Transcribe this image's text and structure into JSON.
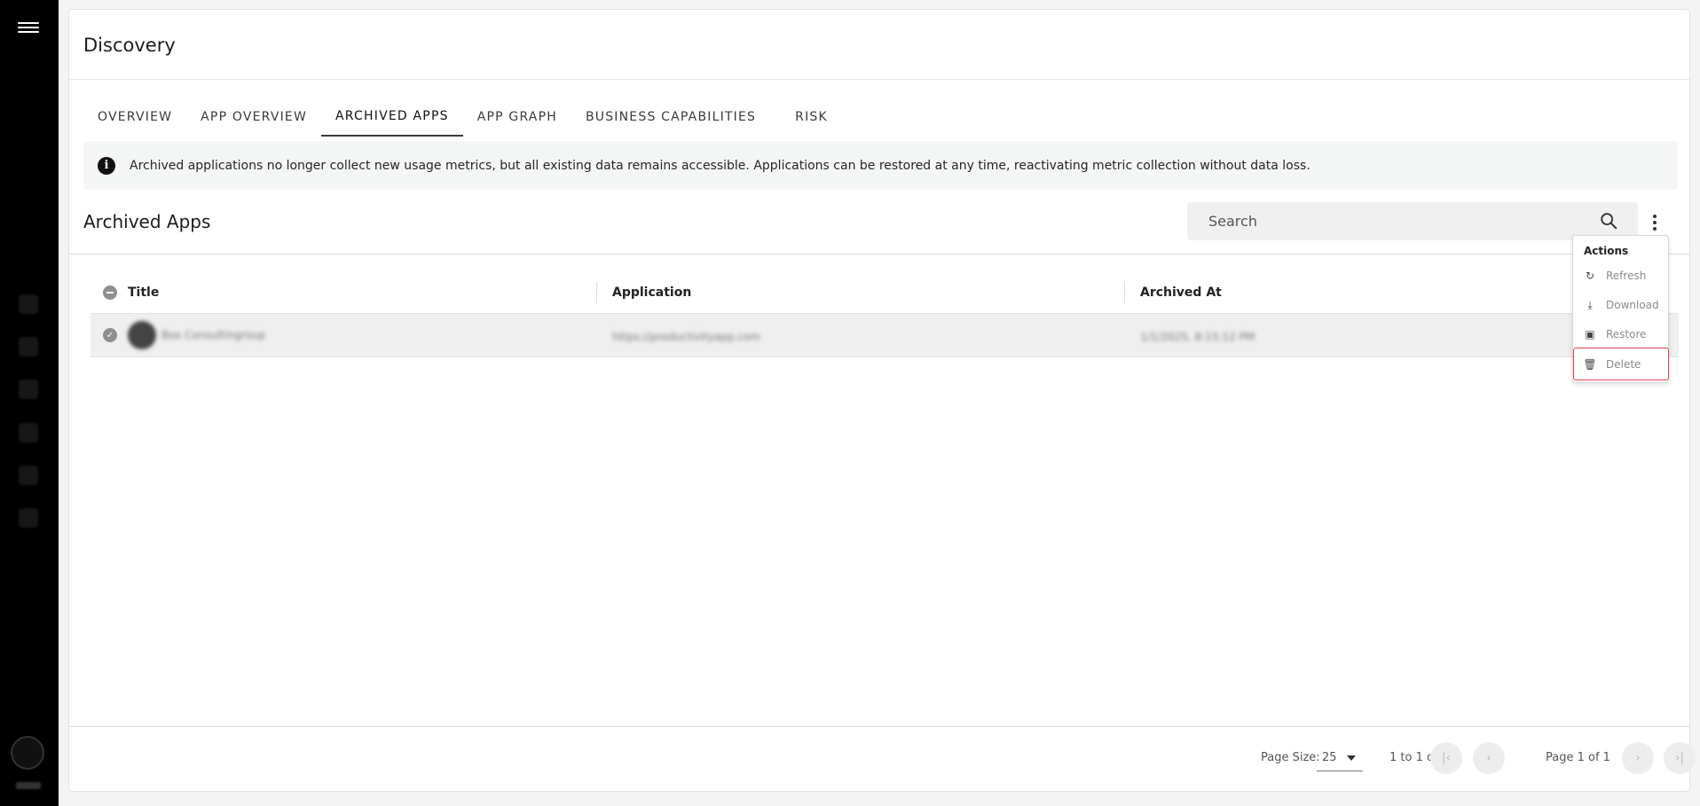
{
  "page": {
    "title": "Discovery"
  },
  "tabs": [
    {
      "label": "OVERVIEW"
    },
    {
      "label": "APP OVERVIEW"
    },
    {
      "label": "ARCHIVED APPS"
    },
    {
      "label": "APP GRAPH"
    },
    {
      "label": "BUSINESS CAPABILITIES"
    },
    {
      "label": "RISK"
    }
  ],
  "active_tab": "ARCHIVED APPS",
  "banner": {
    "message": "Archived applications no longer collect new usage metrics, but all existing data remains accessible. Applications can be restored at any time, reactivating metric collection without data loss."
  },
  "section": {
    "title": "Archived Apps"
  },
  "search": {
    "placeholder": "Search"
  },
  "table": {
    "columns": [
      "Title",
      "Application",
      "Archived At"
    ],
    "rows": [
      {
        "title": "Box Consultingroup",
        "application": "https://productivityapp.com",
        "archived_at": "1/1/2025, 8:15:12 PM"
      }
    ]
  },
  "actions_menu": {
    "title": "Actions",
    "items": [
      {
        "label": "Refresh",
        "icon": "refresh-icon"
      },
      {
        "label": "Download",
        "icon": "download-icon"
      },
      {
        "label": "Restore",
        "icon": "restore-icon"
      },
      {
        "label": "Delete",
        "icon": "trash-icon"
      }
    ]
  },
  "footer": {
    "page_size_label": "Page Size:",
    "page_size": "25",
    "rows_info": "1 to 1 of 1",
    "page_info": "Page 1 of 1"
  },
  "colors": {
    "highlight": "#e0434f",
    "rail": "#000000"
  }
}
